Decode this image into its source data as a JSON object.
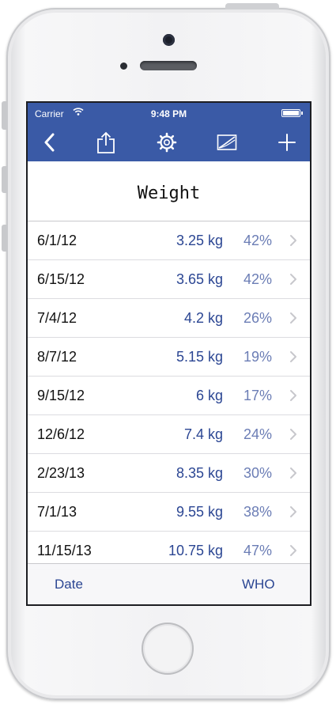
{
  "status_bar": {
    "carrier": "Carrier",
    "time": "9:48 PM"
  },
  "toolbar": {
    "icons": [
      "back-chevron-icon",
      "share-icon",
      "gear-icon",
      "chart-icon",
      "plus-icon"
    ]
  },
  "page": {
    "title": "Weight"
  },
  "measurements": [
    {
      "date": "6/1/12",
      "weight": "3.25 kg",
      "percentile": "42%"
    },
    {
      "date": "6/15/12",
      "weight": "3.65 kg",
      "percentile": "42%"
    },
    {
      "date": "7/4/12",
      "weight": "4.2 kg",
      "percentile": "26%"
    },
    {
      "date": "8/7/12",
      "weight": "5.15 kg",
      "percentile": "19%"
    },
    {
      "date": "9/15/12",
      "weight": "6 kg",
      "percentile": "17%"
    },
    {
      "date": "12/6/12",
      "weight": "7.4 kg",
      "percentile": "24%"
    },
    {
      "date": "2/23/13",
      "weight": "8.35 kg",
      "percentile": "30%"
    },
    {
      "date": "7/1/13",
      "weight": "9.55 kg",
      "percentile": "38%"
    },
    {
      "date": "11/15/13",
      "weight": "10.75 kg",
      "percentile": "47%"
    }
  ],
  "tabbar": {
    "left_label": "Date",
    "right_label": "WHO"
  },
  "colors": {
    "nav_bar": "#3a5aa6",
    "value_blue": "#2b4693",
    "percent_blue": "#6b7db5"
  }
}
